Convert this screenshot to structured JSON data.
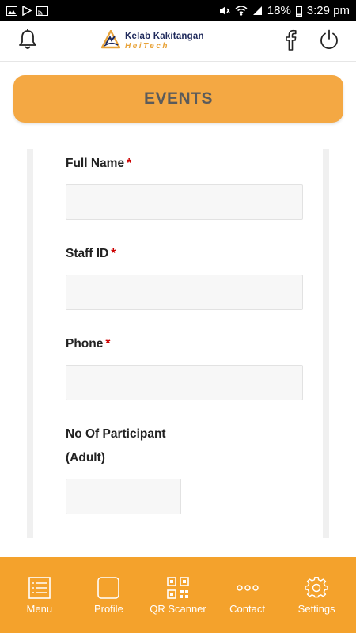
{
  "status_bar": {
    "battery": "18%",
    "time": "3:29 pm"
  },
  "header": {
    "logo_line1": "Kelab Kakitangan",
    "logo_line2": "HeiTech",
    "icons": [
      "bell-icon",
      "facebook-icon",
      "power-icon"
    ]
  },
  "banner": {
    "title": "EVENTS"
  },
  "form": {
    "fields": [
      {
        "label": "Full Name",
        "required_mark": "*",
        "value": ""
      },
      {
        "label": "Staff ID",
        "required_mark": "*",
        "value": ""
      },
      {
        "label": "Phone",
        "required_mark": "*",
        "value": ""
      },
      {
        "label": "No Of Participant",
        "sub_label": "(Adult)",
        "value": ""
      }
    ]
  },
  "bottom_nav": {
    "items": [
      {
        "label": "Menu",
        "icon": "menu-icon"
      },
      {
        "label": "Profile",
        "icon": "profile-icon"
      },
      {
        "label": "QR Scanner",
        "icon": "qr-code-icon"
      },
      {
        "label": "Contact",
        "icon": "more-dots-icon"
      },
      {
        "label": "Settings",
        "icon": "gear-icon"
      }
    ]
  },
  "colors": {
    "accent": "#f4a22c",
    "banner": "#f4a843",
    "required": "#cc0000"
  }
}
